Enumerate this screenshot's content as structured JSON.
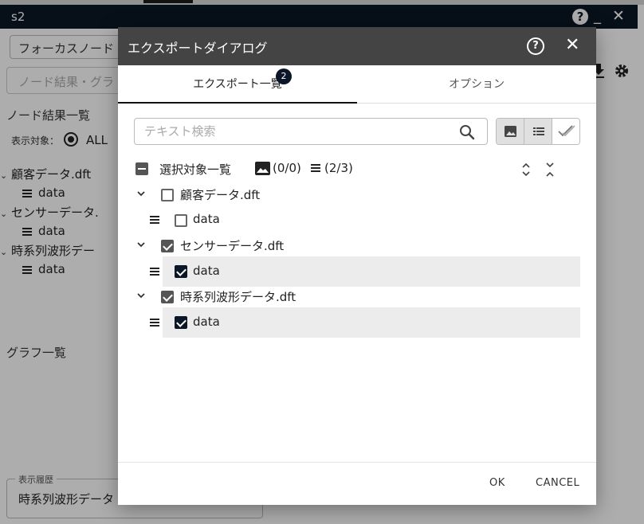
{
  "app": {
    "title": "s2",
    "help_label": "?",
    "minimize_label": "_",
    "close_label": "✕",
    "focus_select": "フォーカスノード",
    "search_placeholder": "ノード結果・グラ",
    "node_results_heading": "ノード結果一覧",
    "display_target_label": "表示対象：",
    "display_target_value": "ALL",
    "tree": [
      {
        "label": "顧客データ.dft",
        "child": "data"
      },
      {
        "label": "センサーデータ.",
        "child": "data"
      },
      {
        "label": "時系列波形デー",
        "child": "data"
      }
    ],
    "graph_heading": "グラフ一覧",
    "history_legend": "表示履歴",
    "history_value": "時系列波形データ"
  },
  "dialog": {
    "title": "エクスポートダイアログ",
    "help_label": "?",
    "close_label": "✕",
    "tabs": [
      {
        "label": "エクスポート一覧",
        "badge": "2",
        "active": true
      },
      {
        "label": "オプション",
        "active": false
      }
    ],
    "search_placeholder": "テキスト検索",
    "selection": {
      "label": "選択対象一覧",
      "image_count": "(0/0)",
      "list_count": "(2/3)"
    },
    "items": [
      {
        "label": "顧客データ.dft",
        "checked": false,
        "child": {
          "label": "data",
          "checked": false
        }
      },
      {
        "label": "センサーデータ.dft",
        "checked": true,
        "child": {
          "label": "data",
          "checked": true
        }
      },
      {
        "label": "時系列波形データ.dft",
        "checked": true,
        "child": {
          "label": "data",
          "checked": true
        }
      }
    ],
    "ok_label": "OK",
    "cancel_label": "CANCEL"
  }
}
